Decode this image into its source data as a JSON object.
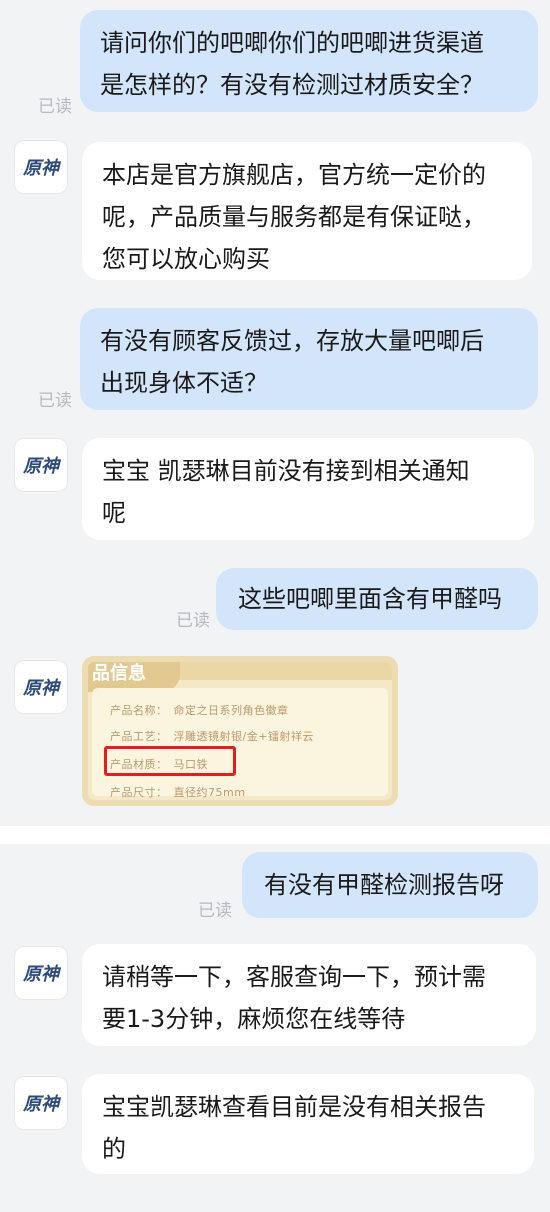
{
  "read_label": "已读",
  "avatar_label": "原神",
  "messages": [
    {
      "dir": "out",
      "lines": [
        "请问你们的吧唧你们的吧唧进货渠道",
        "是怎样的？有没有检测过材质安全？"
      ]
    },
    {
      "dir": "in",
      "lines": [
        "本店是官方旗舰店，官方统一定价的",
        "呢，产品质量与服务都是有保证哒，",
        "您可以放心购买"
      ]
    },
    {
      "dir": "out",
      "lines": [
        "有没有顾客反馈过，存放大量吧唧后",
        "出现身体不适？"
      ]
    },
    {
      "dir": "in",
      "lines": [
        "宝宝 凯瑟琳目前没有接到相关通知",
        "呢"
      ]
    },
    {
      "dir": "out",
      "lines": [
        "这些吧唧里面含有甲醛吗"
      ]
    },
    {
      "dir": "in",
      "type": "image"
    },
    {
      "dir": "out",
      "lines": [
        "有没有甲醛检测报告呀"
      ]
    },
    {
      "dir": "in",
      "lines": [
        "请稍等一下，客服查询一下，预计需",
        "要1-3分钟，麻烦您在线等待"
      ]
    },
    {
      "dir": "in",
      "lines": [
        "宝宝凯瑟琳查看目前是没有相关报告",
        "的"
      ]
    }
  ],
  "product_card": {
    "header": "品信息",
    "rows": [
      {
        "key": "产品名称：",
        "value": "命定之日系列角色徽章"
      },
      {
        "key": "产品工艺：",
        "value": "浮雕透镜射银/金+镭射祥云"
      },
      {
        "key": "产品材质：",
        "value": "马口铁"
      },
      {
        "key": "产品尺寸：",
        "value": "直径约75mm"
      }
    ]
  }
}
